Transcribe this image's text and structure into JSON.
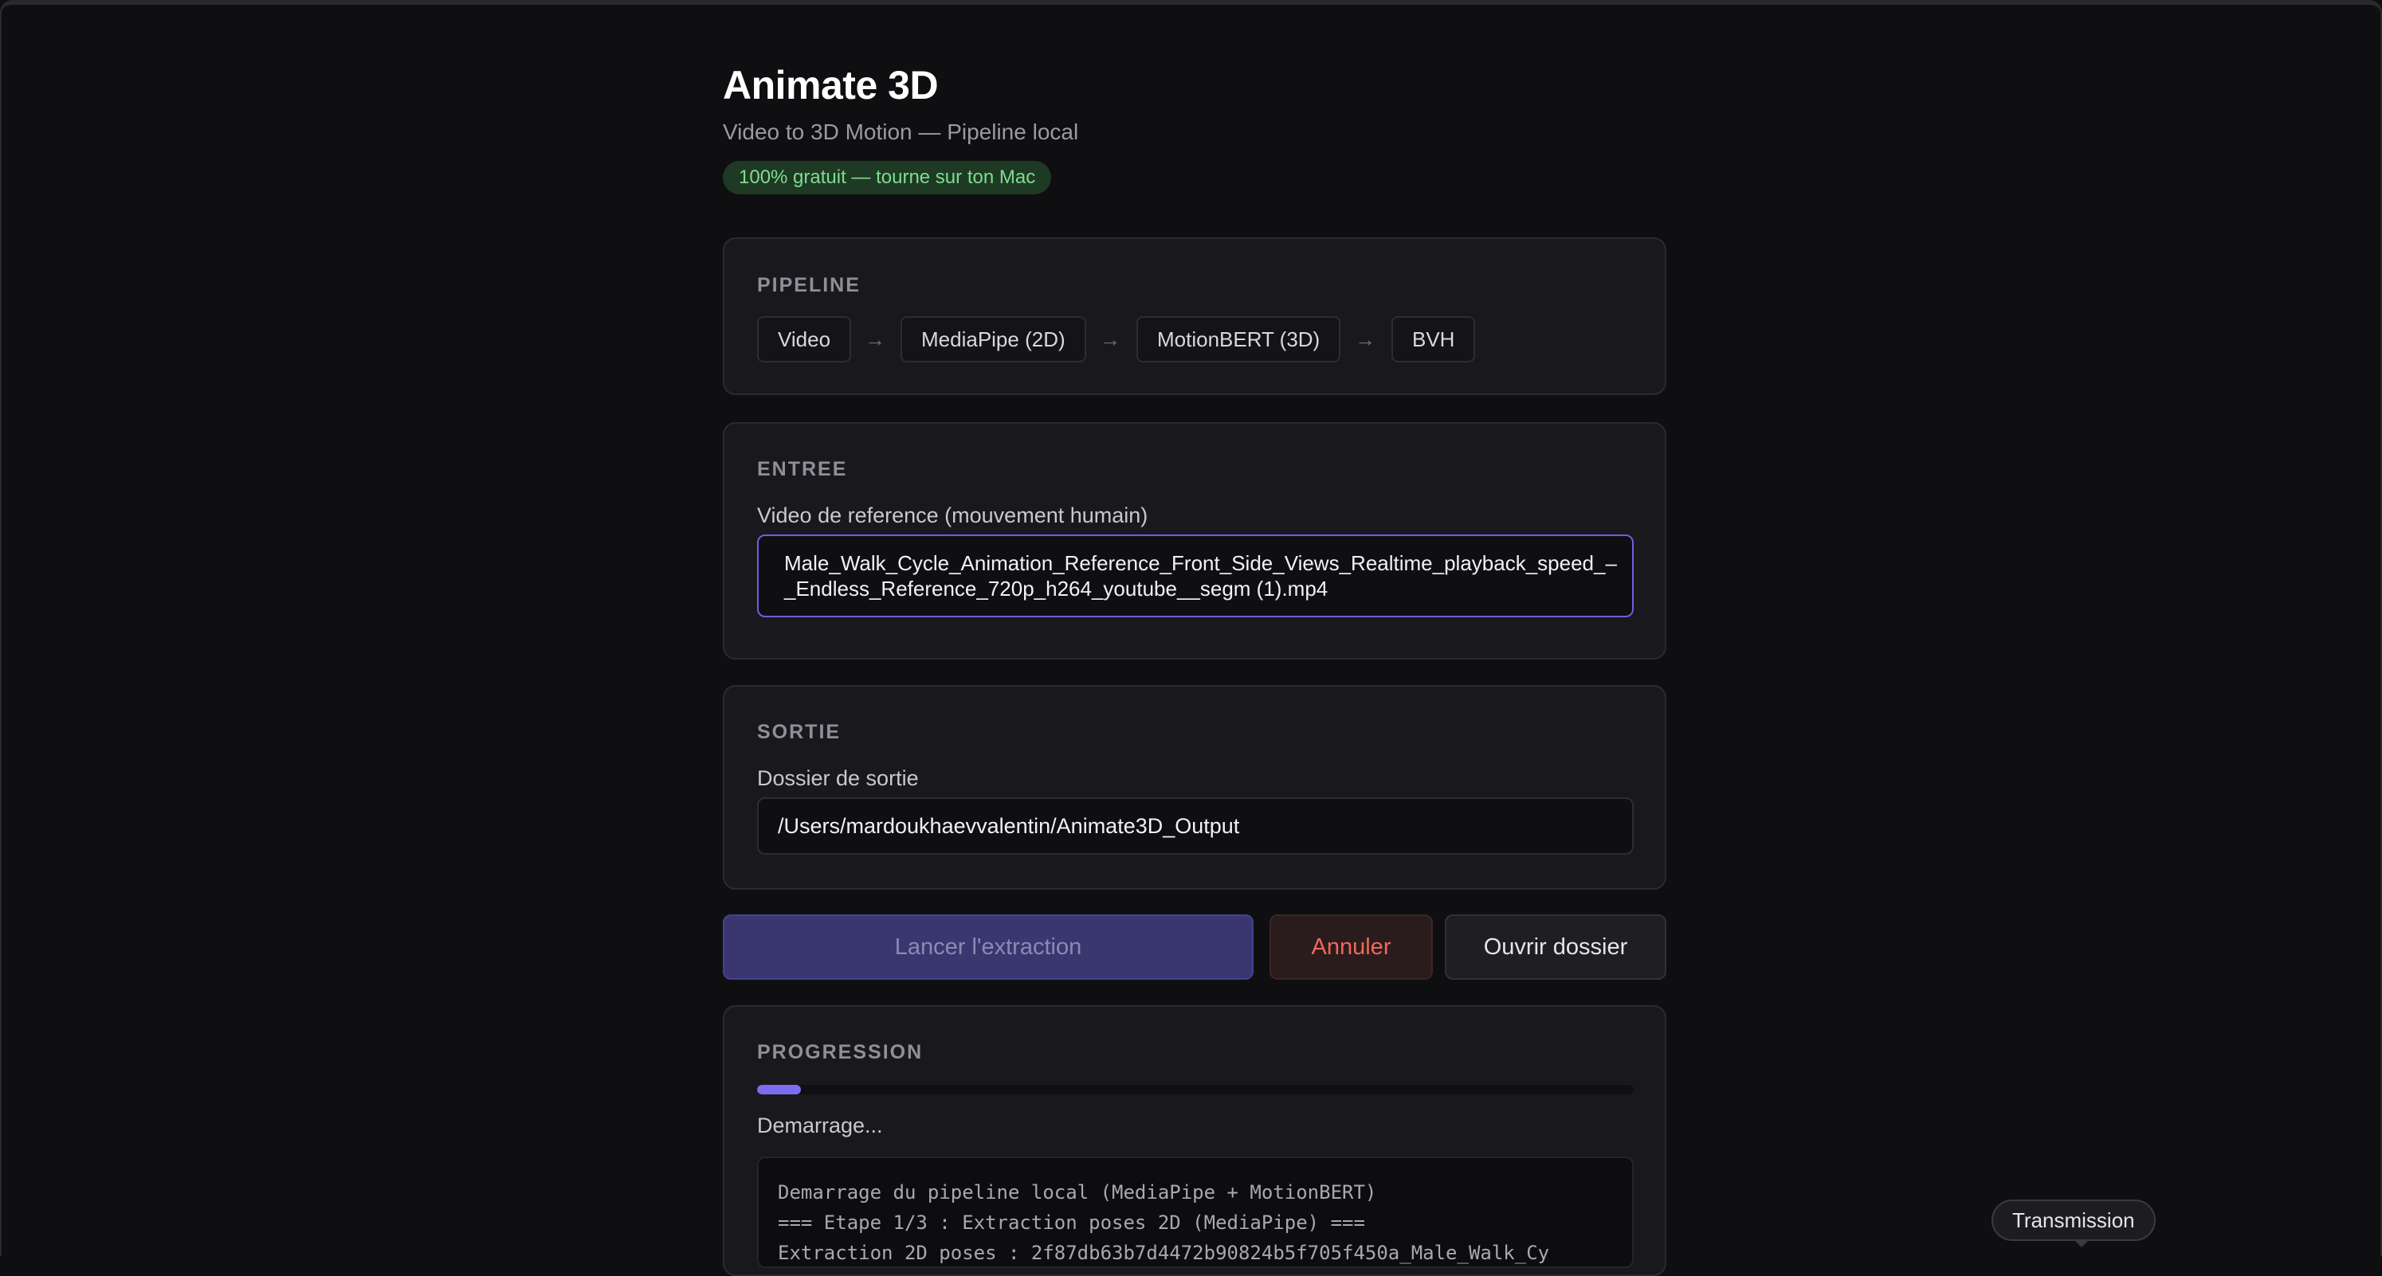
{
  "app": {
    "title": "Animate 3D",
    "subtitle": "Video to 3D Motion — Pipeline local",
    "badge": "100% gratuit — tourne sur ton Mac"
  },
  "pipeline": {
    "section_title": "PIPELINE",
    "steps": [
      "Video",
      "MediaPipe (2D)",
      "MotionBERT (3D)",
      "BVH"
    ],
    "arrow_glyph": "→"
  },
  "input": {
    "section_title": "ENTREE",
    "label": "Video de reference (mouvement humain)",
    "file_line_1": "Male_Walk_Cycle_Animation_Reference_Front_Side_Views_Realtime_playback_speed_–",
    "file_line_2": "_Endless_Reference_720p_h264_youtube__segm (1).mp4"
  },
  "output": {
    "section_title": "SORTIE",
    "label": "Dossier de sortie",
    "folder_value": "/Users/mardoukhaevvalentin/Animate3D_Output"
  },
  "actions": {
    "start_label": "Lancer l'extraction",
    "cancel_label": "Annuler",
    "open_folder_label": "Ouvrir dossier"
  },
  "progress": {
    "section_title": "PROGRESSION",
    "percent": 5,
    "status": "Demarrage...",
    "log_lines": [
      "Demarrage du pipeline local (MediaPipe + MotionBERT)",
      "=== Etape 1/3 : Extraction poses 2D (MediaPipe) ===",
      "Extraction 2D poses : 2f87db63b7d4472b90824b5f705f450a_Male_Walk_Cy"
    ]
  },
  "tooltip": {
    "label": "Transmission"
  },
  "colors": {
    "accent": "#7b6cf0",
    "success": "#7fdc8f",
    "danger": "#f0675c",
    "background": "#0f0f11",
    "card": "#19191d"
  }
}
